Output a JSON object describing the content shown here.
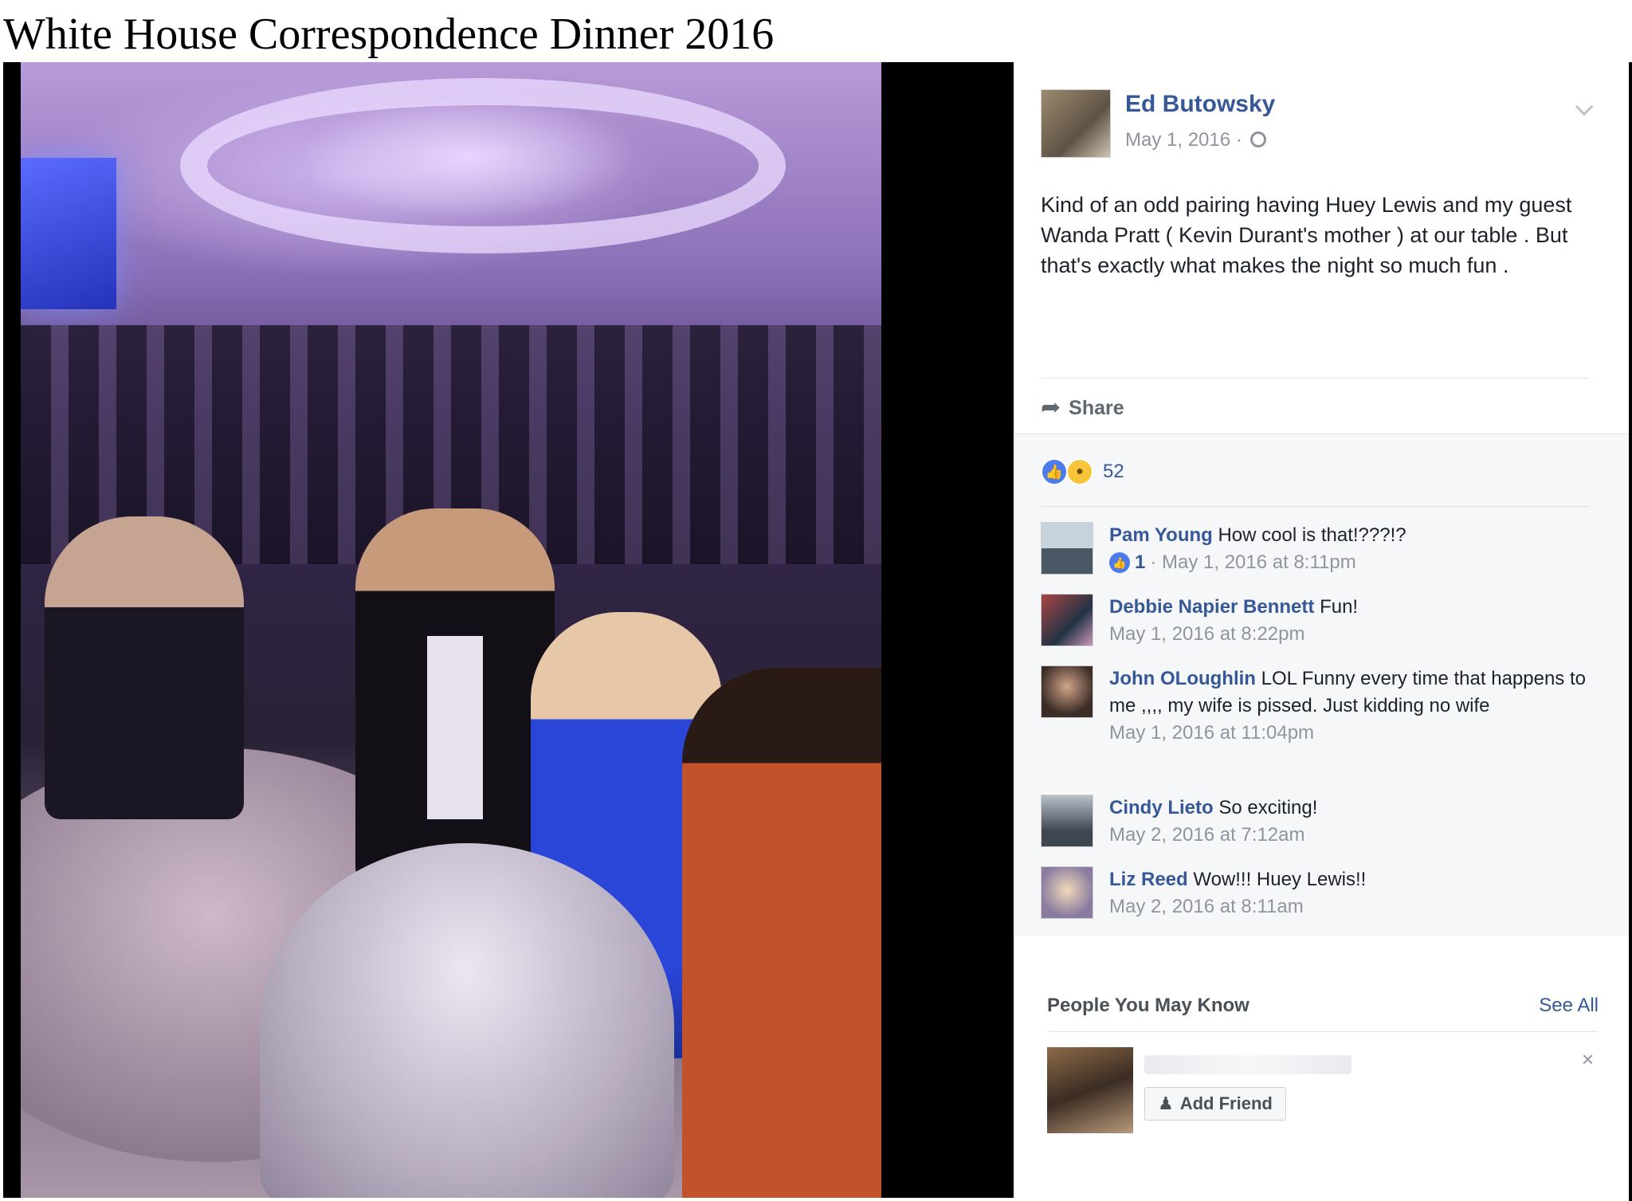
{
  "document": {
    "title": "White House Correspondence Dinner 2016"
  },
  "post": {
    "author": "Ed Butowsky",
    "date": "May 1, 2016 ·",
    "text": "Kind of an odd pairing having Huey Lewis and my guest Wanda Pratt ( Kevin Durant's mother ) at our table . But that's exactly what makes the night so much fun .",
    "share_label": "Share",
    "reaction_count": "52",
    "icons": {
      "privacy": "globe-icon",
      "menu": "chevron-down-icon",
      "share": "share-arrow-icon",
      "like": "like-icon",
      "wow": "wow-icon"
    }
  },
  "comments": [
    {
      "author": "Pam Young",
      "text": "How cool is that!???!?",
      "likes": "1",
      "meta": "· May 1, 2016 at 8:11pm"
    },
    {
      "author": "Debbie Napier Bennett",
      "text": "Fun!",
      "meta": "May 1, 2016 at 8:22pm"
    },
    {
      "author": "John OLoughlin",
      "text": "LOL Funny every time that happens to me ,,,, my wife is pissed. Just kidding no wife",
      "meta": "May 1, 2016 at 11:04pm"
    },
    {
      "author": "Cindy Lieto",
      "text": "So exciting!",
      "meta": "May 2, 2016 at 7:12am"
    },
    {
      "author": "Liz Reed",
      "text": "Wow!!! Huey Lewis!!",
      "meta": "May 2, 2016 at 8:11am"
    }
  ],
  "people_you_may_know": {
    "title": "People You May Know",
    "see_all": "See All",
    "add_friend": "Add Friend"
  },
  "colors": {
    "link_blue": "#365899",
    "meta_gray": "#90949c",
    "like_blue": "#4b7bec",
    "comment_bg": "#f6f7f9"
  }
}
